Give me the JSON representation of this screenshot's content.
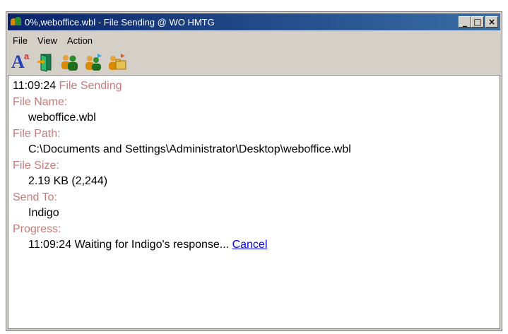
{
  "window": {
    "title": "0%,weboffice.wbl - File Sending @ WO HMTG",
    "minimize_label": "_",
    "maximize_label": "□",
    "close_label": "×"
  },
  "menu": {
    "file": "File",
    "view": "View",
    "action": "Action"
  },
  "toolbar": {
    "icons": [
      "font-icon",
      "door-exit-icon",
      "users-icon",
      "users-arrow-icon",
      "users-folder-icon"
    ],
    "font_glyph_big": "A",
    "font_glyph_small": "a"
  },
  "log": {
    "header_time": "11:09:24",
    "header_label": "File Sending",
    "file_name_label": "File Name:",
    "file_name_value": "weboffice.wbl",
    "file_path_label": "File Path:",
    "file_path_value": "C:\\Documents and Settings\\Administrator\\Desktop\\weboffice.wbl",
    "file_size_label": "File Size:",
    "file_size_value": "2.19 KB (2,244)",
    "send_to_label": "Send To:",
    "send_to_value": "Indigo",
    "progress_label": "Progress:",
    "progress_time": "11:09:24",
    "progress_status": "Waiting for Indigo's response...",
    "cancel_link": "Cancel"
  },
  "colors": {
    "title_bar_start": "#0a246a",
    "title_bar_end": "#3a6ea5",
    "label_red": "#c97a7a",
    "link_blue": "#0000ee"
  }
}
